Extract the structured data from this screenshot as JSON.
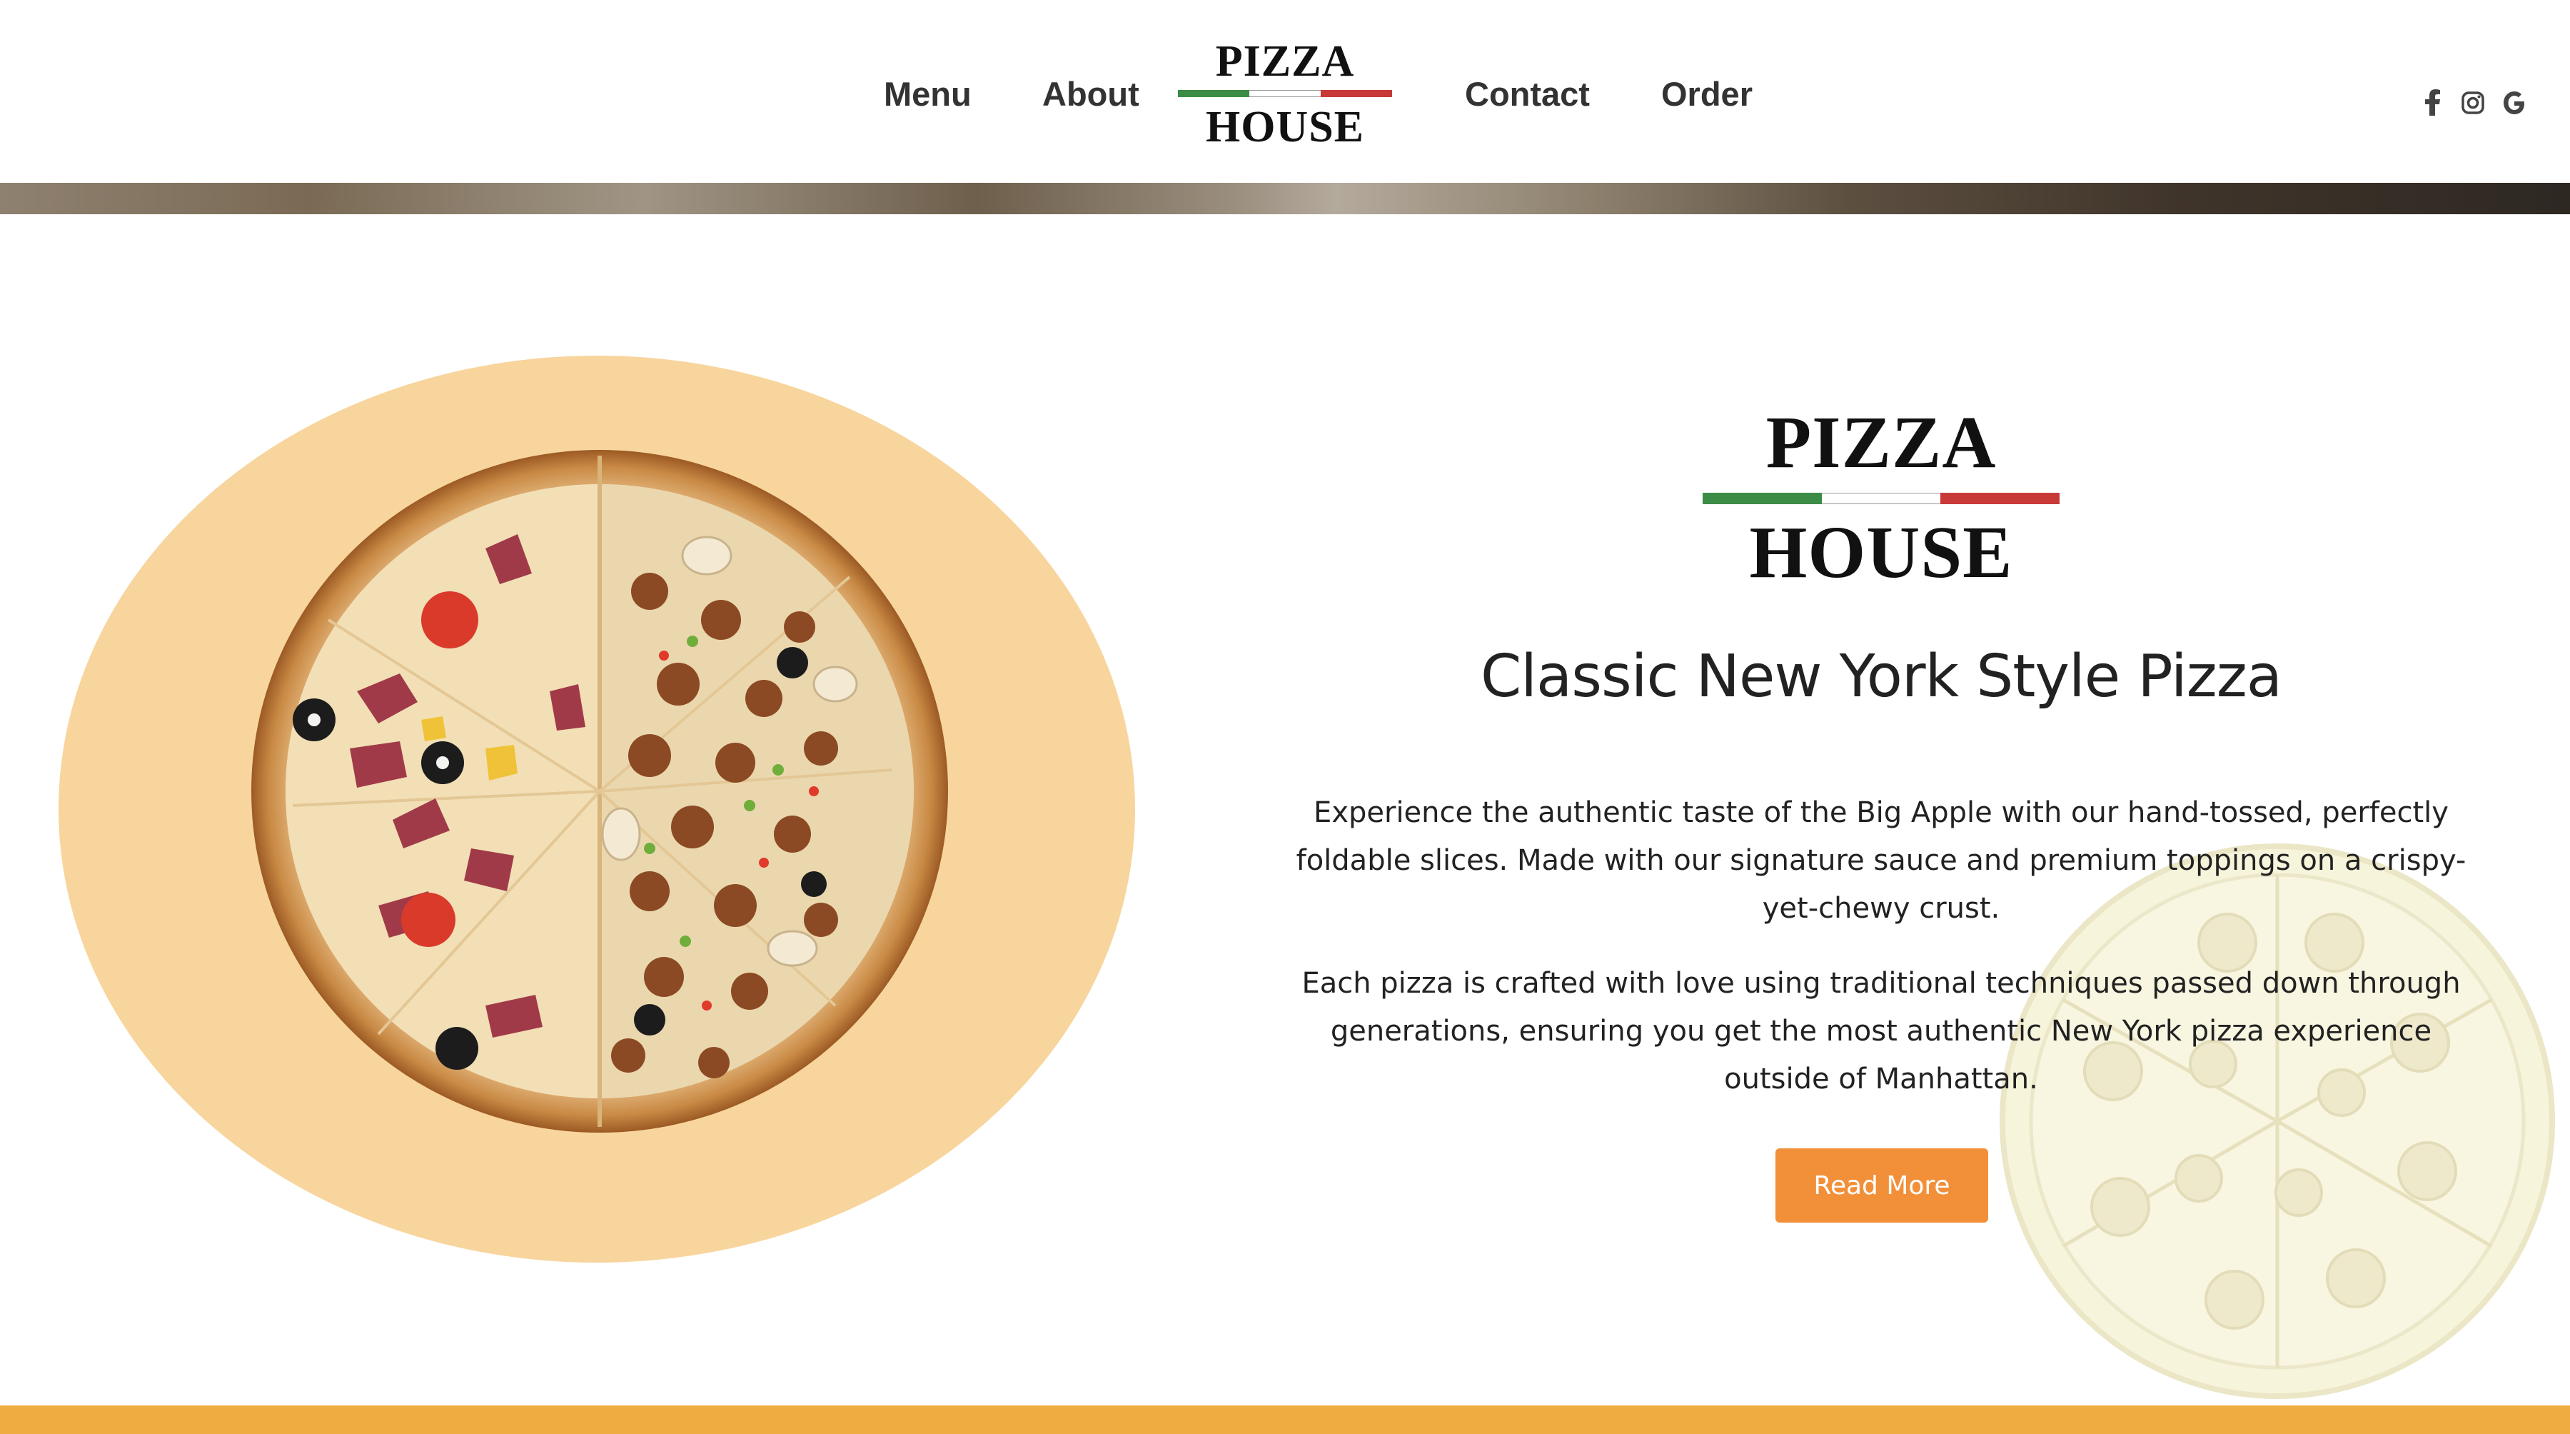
{
  "header": {
    "nav": {
      "menu": "Menu",
      "about": "About",
      "contact": "Contact",
      "order": "Order"
    },
    "logo": {
      "line1": "PIZZA",
      "line2": "HOUSE"
    },
    "social": [
      {
        "icon": "facebook-icon",
        "glyph": "f"
      },
      {
        "icon": "instagram-icon",
        "glyph": ""
      },
      {
        "icon": "google-icon",
        "glyph": "G"
      }
    ]
  },
  "hero": {
    "logo": {
      "line1": "PIZZA",
      "line2": "HOUSE"
    },
    "subtitle": "Classic New York Style Pizza",
    "paragraph1": "Experience the authentic taste of the Big Apple with our hand-tossed, perfectly foldable slices. Made with our signature sauce and premium toppings on a crispy-yet-chewy crust.",
    "paragraph2": "Each pizza is crafted with love using traditional techniques passed down through generations, ensuring you get the most authentic New York pizza experience outside of Manhattan.",
    "button": "Read More"
  },
  "colors": {
    "accent": "#f2903a",
    "plate": "#f8d59d",
    "footer_band": "#efac40",
    "flag_green": "#3c8c45",
    "flag_red": "#c83a38"
  }
}
